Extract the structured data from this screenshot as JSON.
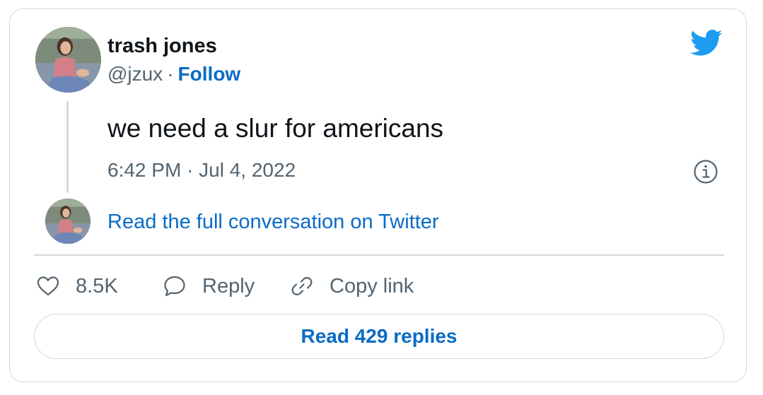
{
  "author": {
    "display_name": "trash jones",
    "handle": "@jzux",
    "separator": "·",
    "follow_label": "Follow"
  },
  "tweet": {
    "text": "we need a slur for americans",
    "timestamp": "6:42 PM · Jul 4, 2022"
  },
  "conversation": {
    "link_label": "Read the full conversation on Twitter"
  },
  "actions": {
    "like_count": "8.5K",
    "reply_label": "Reply",
    "copy_label": "Copy link"
  },
  "replies": {
    "label": "Read 429 replies"
  },
  "icons": {
    "brand": "twitter-bird-icon",
    "info": "info-icon",
    "like": "heart-icon",
    "reply": "speech-bubble-icon",
    "copy": "link-icon"
  },
  "colors": {
    "brand_blue": "#1d9bf0",
    "link_blue": "#0a6bc7",
    "text_primary": "#0f1419",
    "text_secondary": "#536471",
    "border": "#cfd9de"
  }
}
